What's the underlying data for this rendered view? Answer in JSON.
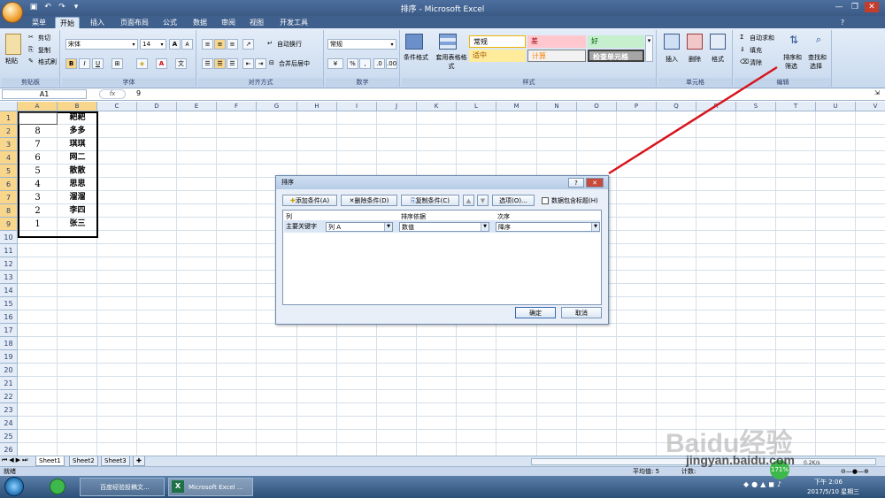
{
  "window": {
    "title": "排序 - Microsoft Excel",
    "minimize": "—",
    "restore": "❐",
    "close": "✕"
  },
  "tabs": [
    "菜单",
    "开始",
    "插入",
    "页面布局",
    "公式",
    "数据",
    "审阅",
    "视图",
    "开发工具"
  ],
  "active_tab": "开始",
  "ribbon": {
    "clipboard": {
      "paste": "粘贴",
      "cut": "剪切",
      "copy": "复制",
      "format_painter": "格式刷",
      "label": "剪贴板"
    },
    "font": {
      "name": "宋体",
      "size": "14",
      "bold": "B",
      "italic": "I",
      "underline": "U",
      "label": "字体",
      "grow": "A",
      "shrink": "A"
    },
    "alignment": {
      "wrap": "自动换行",
      "merge": "合并后居中",
      "label": "对齐方式"
    },
    "number": {
      "format": "常规",
      "percent": "%",
      "comma": ",",
      "label": "数字"
    },
    "styles": {
      "cond_format": "条件格式",
      "table_format": "套用表格格式",
      "normal": "常规",
      "bad": "差",
      "good": "好",
      "neutral": "适中",
      "calculation": "计算",
      "check_cell": "检查单元格",
      "label": "样式"
    },
    "cells": {
      "insert": "插入",
      "delete": "删除",
      "format": "格式",
      "label": "单元格"
    },
    "editing": {
      "autosum": "自动求和",
      "fill": "填充",
      "clear": "清除",
      "sort_filter_1": "排序和",
      "sort_filter_2": "筛选",
      "find_select_1": "查找和",
      "find_select_2": "选择",
      "label": "编辑"
    }
  },
  "formula_bar": {
    "name_box": "A1",
    "fx": "fx",
    "value": "9"
  },
  "columns": [
    "A",
    "B",
    "C",
    "D",
    "E",
    "F",
    "G",
    "H",
    "I",
    "J",
    "K",
    "L",
    "M",
    "N",
    "O",
    "P",
    "Q",
    "R",
    "S",
    "T",
    "U",
    "V"
  ],
  "rows": [
    "1",
    "2",
    "3",
    "4",
    "5",
    "6",
    "7",
    "8",
    "9",
    "10",
    "11",
    "12",
    "13",
    "14",
    "15",
    "16",
    "17",
    "18",
    "19",
    "20",
    "21",
    "22",
    "23",
    "24",
    "25",
    "26"
  ],
  "cells": [
    {
      "a": "9",
      "b": "耙耙"
    },
    {
      "a": "8",
      "b": "多多"
    },
    {
      "a": "7",
      "b": "琪琪"
    },
    {
      "a": "6",
      "b": "网二"
    },
    {
      "a": "5",
      "b": "散散"
    },
    {
      "a": "4",
      "b": "思思"
    },
    {
      "a": "3",
      "b": "溜溜"
    },
    {
      "a": "2",
      "b": "李四"
    },
    {
      "a": "1",
      "b": "张三"
    }
  ],
  "sheets": [
    "Sheet1",
    "Sheet2",
    "Sheet3"
  ],
  "status": {
    "ready": "就绪",
    "average": "平均值: 5",
    "count": "计数:",
    "zoom": "171%"
  },
  "dialog": {
    "title": "排序",
    "help": "?",
    "close": "✕",
    "add_level": "添加条件(A)",
    "delete_level": "删除条件(D)",
    "copy_level": "复制条件(C)",
    "move_up": "▲",
    "move_down": "▼",
    "options": "选项(O)...",
    "has_headers": "数据包含标题(H)",
    "col_header": "列",
    "sorton_header": "排序依据",
    "order_header": "次序",
    "row_label": "主要关键字",
    "column_value": "列 A",
    "sorton_value": "数值",
    "order_value": "降序",
    "ok": "确定",
    "cancel": "取消"
  },
  "taskbar": {
    "tasks": [
      "百度经验投稿文...",
      "Microsoft Excel ..."
    ],
    "time": "下午 2:06",
    "date": "2017/5/10 星期三",
    "net_speed": "0.2K/s"
  },
  "watermark": {
    "brand": "Baidu经验",
    "url": "jingyan.baidu.com"
  },
  "colors": {
    "title_bar": "#3b5a85",
    "ribbon": "#dce7f4",
    "selection_header": "#f8d68b",
    "annotation": "#d8141c"
  }
}
